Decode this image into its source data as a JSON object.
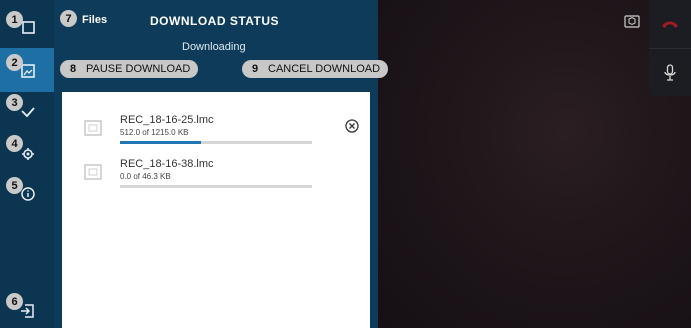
{
  "rail": {
    "badges": [
      "1",
      "2",
      "3",
      "4",
      "5",
      "6"
    ]
  },
  "panel": {
    "files_badge": "7",
    "files_label": "Files",
    "title": "DOWNLOAD STATUS",
    "subtitle": "Downloading",
    "pause_badge": "8",
    "pause_label": "PAUSE DOWNLOAD",
    "cancel_badge": "9",
    "cancel_label": "CANCEL DOWNLOAD"
  },
  "downloads": [
    {
      "name": "REC_18-16-25.lmc",
      "size": "512.0 of 1215.0 KB",
      "progress": 0.421
    },
    {
      "name": "REC_18-16-38.lmc",
      "size": "0.0 of 46.3 KB",
      "progress": 0.0
    }
  ],
  "colors": {
    "rail_bg": "#0c3552",
    "rail_active": "#1e6fa3",
    "panel_bg": "#0d3b59",
    "progress_fill": "#1f77b4",
    "end_call_red": "#a11b24"
  },
  "icons": {
    "rail": [
      "window-icon",
      "gallery-icon",
      "checkmark-icon",
      "settings-icon",
      "info-icon",
      "logout-icon"
    ],
    "right": [
      "cube-icon",
      "end-call-icon",
      "microphone-icon"
    ]
  }
}
